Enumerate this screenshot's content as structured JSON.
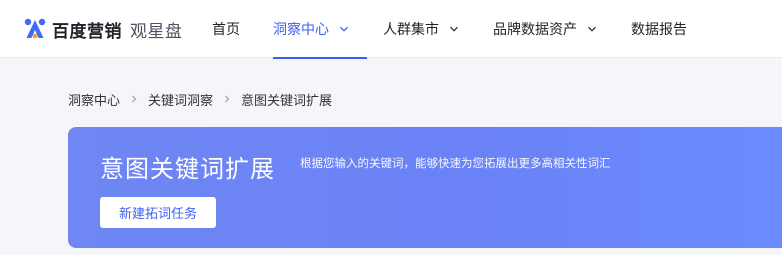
{
  "brand": {
    "name": "百度营销",
    "product": "观星盘"
  },
  "nav": {
    "items": [
      {
        "label": "首页",
        "active": false,
        "dropdown": false
      },
      {
        "label": "洞察中心",
        "active": true,
        "dropdown": true
      },
      {
        "label": "人群集市",
        "active": false,
        "dropdown": true
      },
      {
        "label": "品牌数据资产",
        "active": false,
        "dropdown": true
      },
      {
        "label": "数据报告",
        "active": false,
        "dropdown": false
      }
    ]
  },
  "breadcrumb": {
    "items": [
      "洞察中心",
      "关键词洞察",
      "意图关键词扩展"
    ]
  },
  "banner": {
    "title": "意图关键词扩展",
    "description": "根据您输入的关键词，能够快速为您拓展出更多高相关性词汇",
    "button_label": "新建拓词任务"
  },
  "colors": {
    "accent": "#3d5ef5",
    "banner_start": "#6f86f3",
    "banner_end": "#6b8bff",
    "page_bg": "#f5f6f9"
  }
}
